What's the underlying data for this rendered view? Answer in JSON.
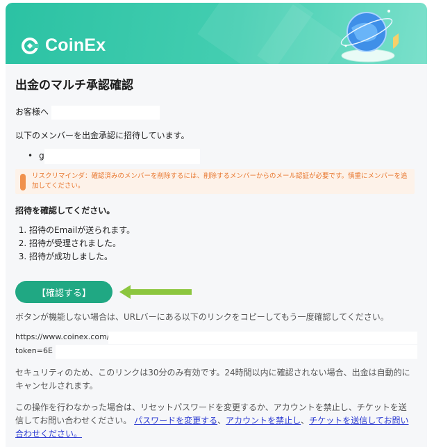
{
  "brand": {
    "name": "CoinEx",
    "accent": "#2bc2a3",
    "button_color": "#20a883",
    "warning_color": "#f0914d"
  },
  "title": "出金のマルチ承認確認",
  "greeting": "お客様へ",
  "invite_intro": "以下のメンバーを出金承認に招待しています。",
  "member": "g",
  "reminder": "リスクリマインダ：確認済みのメンバーを削除するには、削除するメンバーからのメール認証が必要です。慎重にメンバーを追加してください。",
  "confirm_prompt": "招待を確認してください。",
  "steps": [
    "招待のEmailが送られます。",
    "招待が受理されました。",
    "招待が成功しました。"
  ],
  "confirm_button": "【確認する】",
  "fallback_text": "ボタンが機能しない場合は、URLバーにある以下のリンクをコピーしてもう一度確認してください。",
  "link_line1": "https://www.coinex.com/",
  "link_line2": "token=6E",
  "security_text": "セキュリティのため、このリンクは30分のみ有効です。24時間以内に確認されない場合、出金は自動的にキャンセルされます。",
  "footer": {
    "text": "この操作を行わなかった場合は、リセットパスワードを変更するか、アカウントを禁止し、チケットを送信してお問い合わせください。",
    "link_password": "パスワードを変更する",
    "sep1": "、",
    "link_ban": "アカウントを禁止し",
    "sep2": "、",
    "link_ticket": "チケットを送信してお問い合わせください。"
  }
}
